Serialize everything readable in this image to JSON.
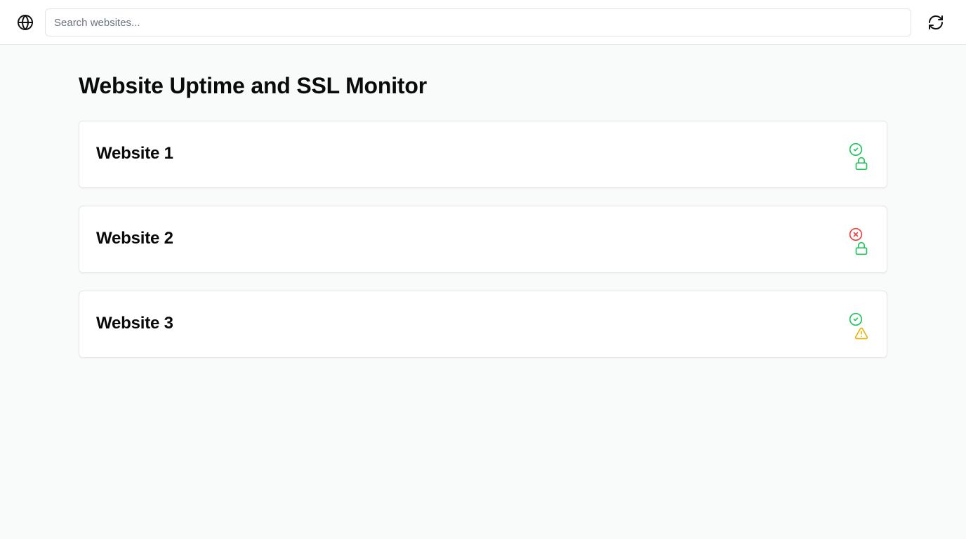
{
  "header": {
    "search_placeholder": "Search websites...",
    "search_value": ""
  },
  "main": {
    "title": "Website Uptime and SSL Monitor",
    "sites": [
      {
        "name": "Website 1",
        "uptime_status": "up",
        "uptime_icon": "check-circle-icon",
        "ssl_status": "valid",
        "ssl_icon": "lock-icon"
      },
      {
        "name": "Website 2",
        "uptime_status": "down",
        "uptime_icon": "x-circle-icon",
        "ssl_status": "valid",
        "ssl_icon": "lock-icon"
      },
      {
        "name": "Website 3",
        "uptime_status": "up",
        "uptime_icon": "check-circle-icon",
        "ssl_status": "warning",
        "ssl_icon": "warning-triangle-icon"
      }
    ]
  },
  "colors": {
    "up": "#22c55e",
    "down": "#ef4444",
    "warning": "#eab308"
  }
}
